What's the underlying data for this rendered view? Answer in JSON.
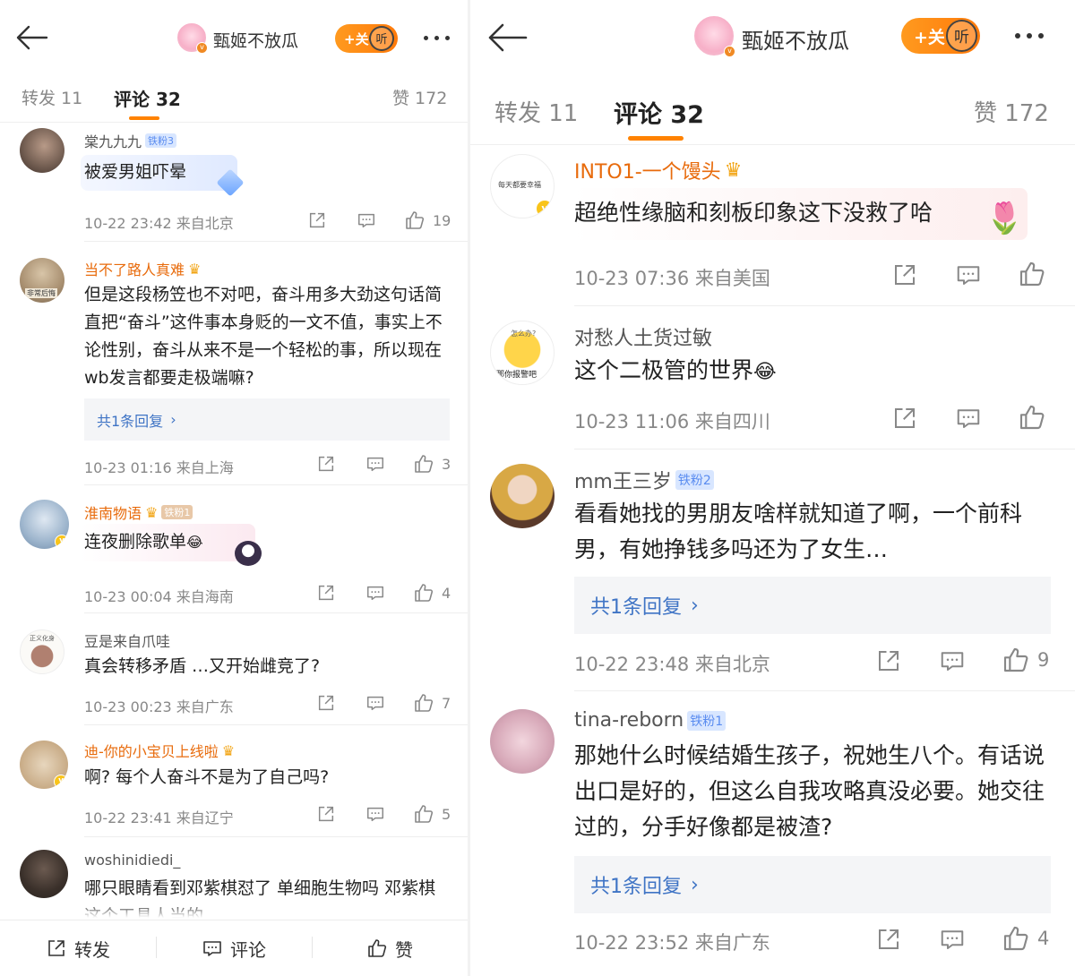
{
  "left": {
    "header": {
      "name": "甄姬不放瓜",
      "follow": "+关",
      "listen": "听"
    },
    "tabs": {
      "repost": "转发 11",
      "comments": "评论 32",
      "likes": "赞 172"
    },
    "comments": [
      {
        "user": "棠九九九",
        "badge": "铁粉3",
        "text": "被爱男姐吓晕",
        "time": "10-22 23:42",
        "loc": "来自北京",
        "likes": "19"
      },
      {
        "user": "当不了路人真难",
        "text": "但是这段杨笠也不对吧，奋斗用多大劲这句话简直把“奋斗”这件事本身贬的一文不值，事实上不论性别，奋斗从来不是一个轻松的事，所以现在wb发言都要走极端嘛?",
        "reply": "共1条回复",
        "time": "10-23 01:16",
        "loc": "来自上海",
        "likes": "3",
        "avatar_text": "非常后悔"
      },
      {
        "user": "淮南物语",
        "badge": "铁粉1",
        "text": "连夜删除歌单",
        "time": "10-23 00:04",
        "loc": "来自海南",
        "likes": "4"
      },
      {
        "user": "豆是来自爪哇",
        "text": "真会转移矛盾 …又开始雌竞了?",
        "time": "10-23 00:23",
        "loc": "来自广东",
        "likes": "7",
        "avatar_text": "正义化身"
      },
      {
        "user": "迪-你的小宝贝上线啦",
        "text": "啊? 每个人奋斗不是为了自己吗?",
        "time": "10-22 23:41",
        "loc": "来自辽宁",
        "likes": "5"
      },
      {
        "user": "woshinidiedi_",
        "text": "哪只眼睛看到邓紫棋怼了 单细胞生物吗 邓紫棋这个工具人当的"
      }
    ],
    "bottom": {
      "repost": "转发",
      "comment": "评论",
      "like": "赞"
    }
  },
  "right": {
    "header": {
      "name": "甄姬不放瓜",
      "follow": "+关",
      "listen": "听"
    },
    "tabs": {
      "repost": "转发 11",
      "comments": "评论 32",
      "likes": "赞 172"
    },
    "comments": [
      {
        "user": "INTO1-一个馒头",
        "text": "超绝性缘脑和刻板印象这下没救了哈",
        "time": "10-23 07:36",
        "loc": "来自美国",
        "likes": "",
        "avatar_text": "每天都要幸福"
      },
      {
        "user": "对愁人土货过敏",
        "text": "这个二极管的世界",
        "time": "10-23 11:06",
        "loc": "来自四川",
        "likes": "",
        "avatar_text": "那你报警吧",
        "avatar_top_text": "怎么办?"
      },
      {
        "user": "mm王三岁",
        "badge": "铁粉2",
        "text": "看看她找的男朋友啥样就知道了啊，一个前科男，有她挣钱多吗还为了女生…",
        "reply": "共1条回复",
        "time": "10-22 23:48",
        "loc": "来自北京",
        "likes": "9"
      },
      {
        "user": "tina-reborn",
        "badge": "铁粉1",
        "text": "那她什么时候结婚生孩子，祝她生八个。有话说出口是好的，但这么自我攻略真没必要。她交往过的，分手好像都是被渣?",
        "reply": "共1条回复",
        "time": "10-22 23:52",
        "loc": "来自广东",
        "likes": "4"
      }
    ]
  },
  "colors": {
    "accent": "#ff8200",
    "username": "#e86b0c",
    "link": "#3f74c5",
    "badge_bg": "#d8e6ff"
  }
}
